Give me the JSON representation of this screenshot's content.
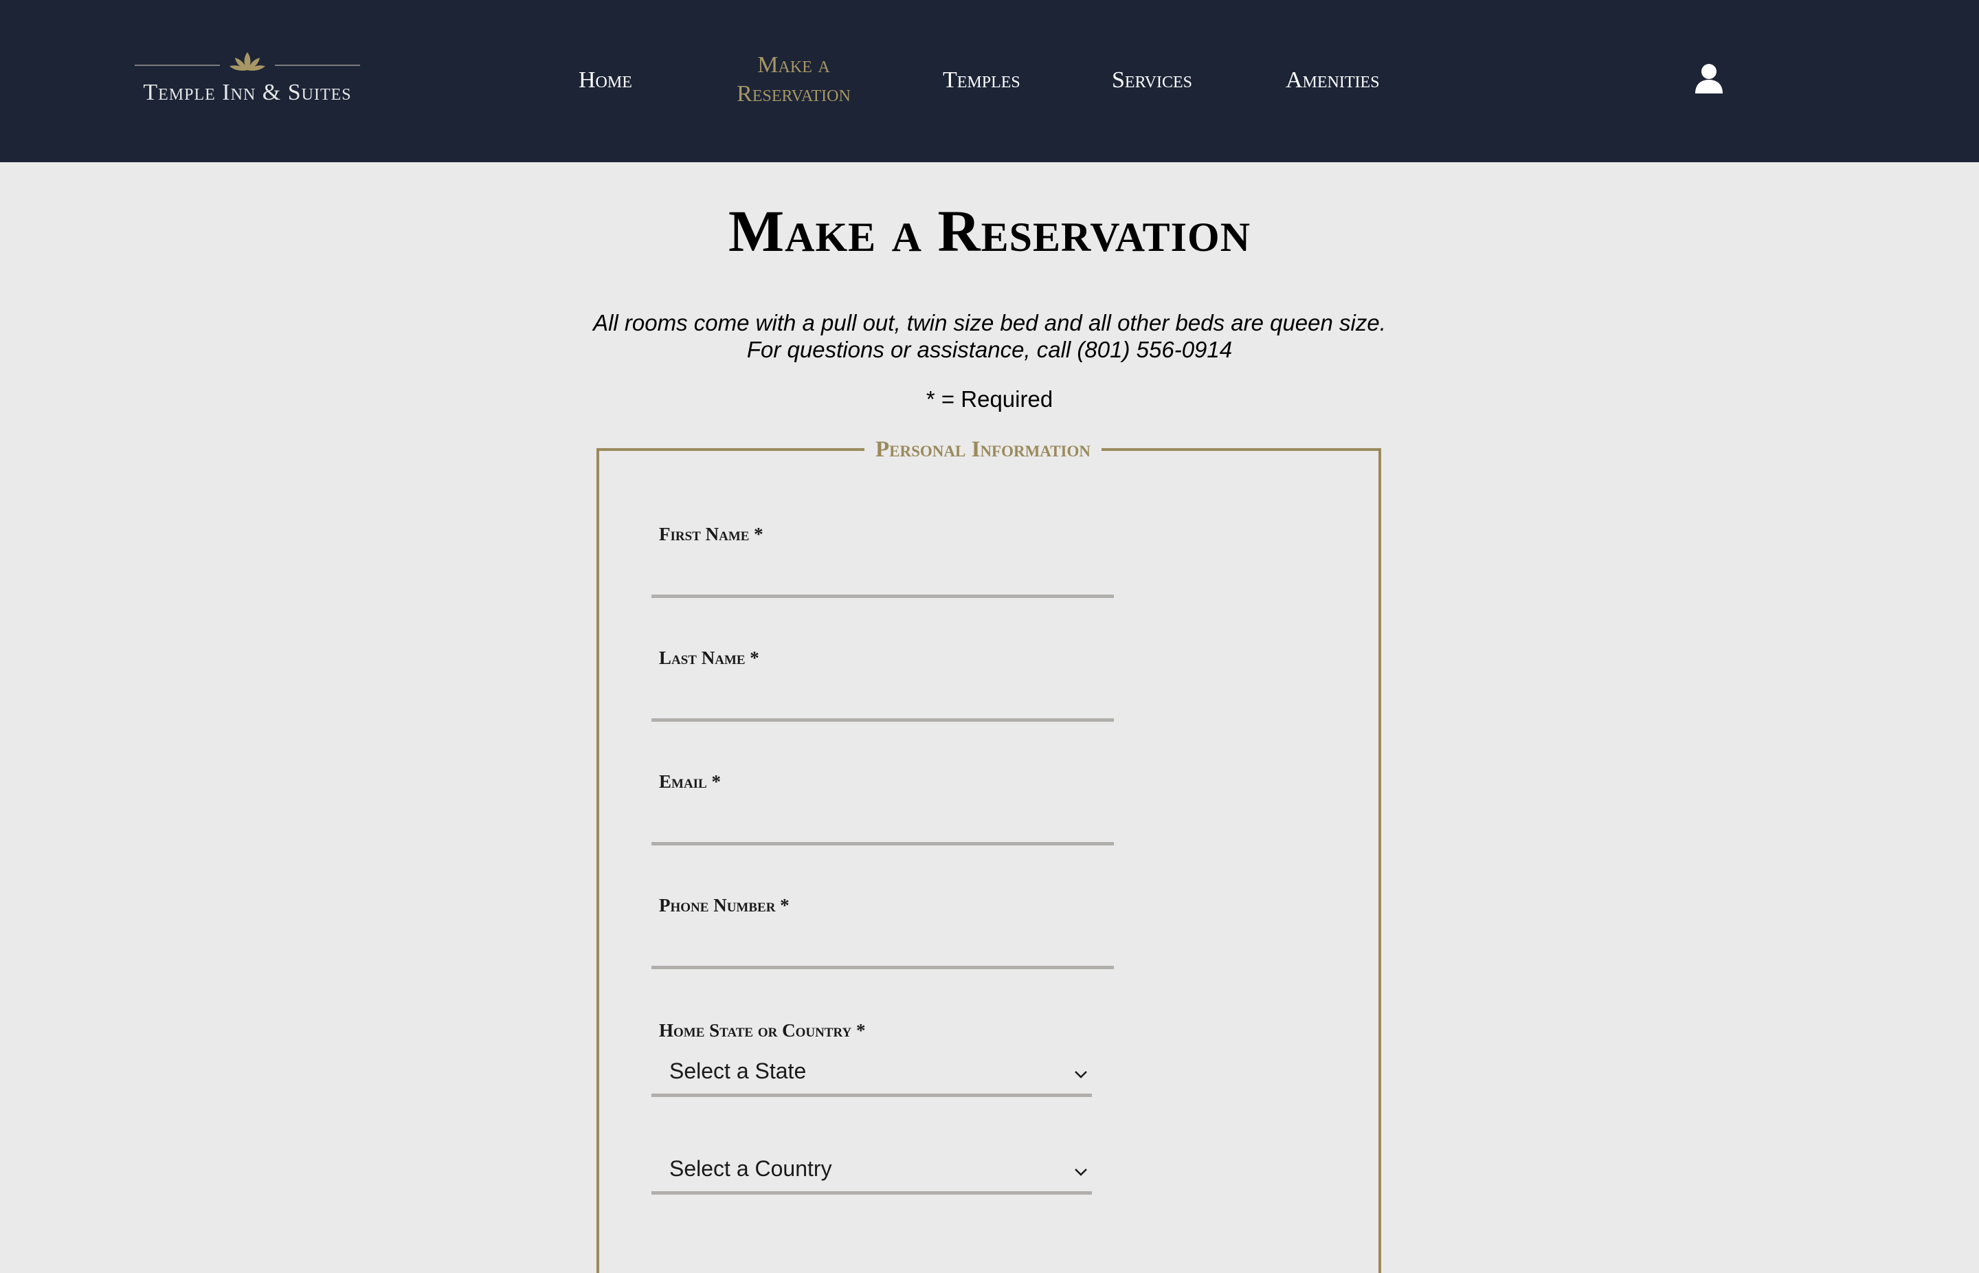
{
  "header": {
    "logo_text": "Temple Inn & Suites",
    "nav": [
      {
        "label": "Home"
      },
      {
        "label": "Make a Reservation",
        "active": true
      },
      {
        "label": "Temples"
      },
      {
        "label": "Services"
      },
      {
        "label": "Amenities"
      }
    ],
    "user_icon": "user-icon"
  },
  "main": {
    "title": "Make a Reservation",
    "intro_line1": "All rooms come with a pull out, twin size bed and all other beds are queen size.",
    "intro_line2": "For questions or assistance, call (801) 556-0914",
    "required_note": "* = Required"
  },
  "form": {
    "legend": "Personal Information",
    "fields": [
      {
        "label": "First Name *",
        "value": ""
      },
      {
        "label": "Last Name *",
        "value": ""
      },
      {
        "label": "Email *",
        "value": ""
      },
      {
        "label": "Phone Number *",
        "value": ""
      }
    ],
    "home_label": "Home State or Country *",
    "state_select": "Select a State",
    "country_select": "Select a Country"
  },
  "colors": {
    "header_bg": "#1c2436",
    "accent_gold": "#9a8a5c",
    "page_bg": "#eaeaea"
  }
}
